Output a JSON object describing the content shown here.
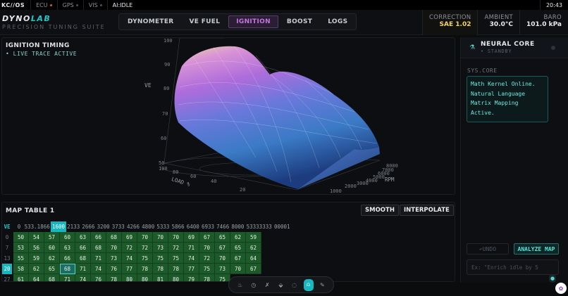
{
  "statusbar": {
    "brand": "KC//OS",
    "items": [
      {
        "label": "ECU",
        "color": "#e04a5a"
      },
      {
        "label": "GPS",
        "color": "#4a4f57"
      },
      {
        "label": "VIS",
        "color": "#4a4f57"
      },
      {
        "label": "AI:IDLE",
        "color": ""
      }
    ],
    "clock": "20:43"
  },
  "header": {
    "logo_main": "DYNO",
    "logo_accent": "LAB",
    "tagline": "PRECISION TUNING SUITE",
    "tabs": [
      {
        "label": "DYNOMETER",
        "active": false
      },
      {
        "label": "VE FUEL",
        "active": false
      },
      {
        "label": "IGNITION",
        "active": true
      },
      {
        "label": "BOOST",
        "active": false
      },
      {
        "label": "LOGS",
        "active": false
      }
    ],
    "readouts": [
      {
        "key": "CORRECTION",
        "value": "SAE 1.02"
      },
      {
        "key": "AMBIENT",
        "value": "30.0°C"
      },
      {
        "key": "BARO",
        "value": "101.0 kPa"
      }
    ]
  },
  "graph": {
    "title": "IGNITION TIMING",
    "status": "• LIVE TRACE ACTIVE",
    "z_label": "VE",
    "z_ticks": [
      "100",
      "90",
      "80",
      "70",
      "60",
      "50"
    ],
    "x_label": "LOAD %",
    "x_ticks": [
      "100",
      "80",
      "60",
      "40",
      "20"
    ],
    "y_label": "RPM",
    "y_ticks": [
      "8000",
      "7000",
      "6000",
      "5000",
      "4000",
      "3000",
      "2000",
      "1000"
    ]
  },
  "map_table": {
    "title": "MAP TABLE 1",
    "smooth": "SMOOTH",
    "interpolate": "INTERPOLATE",
    "corner": "VE",
    "col_headers": [
      "0",
      "533.1866",
      "1600",
      "2133",
      "2666",
      "3200",
      "3733",
      "4266",
      "4800",
      "5333",
      "5866",
      "6400",
      "6933",
      "7466",
      "8000",
      "53333333",
      "00001"
    ],
    "highlight_col": 2,
    "rows": [
      {
        "label": "0",
        "values": [
          "50",
          "54",
          "57",
          "60",
          "63",
          "66",
          "68",
          "69",
          "70",
          "70",
          "70",
          "69",
          "67",
          "65",
          "62",
          "59"
        ]
      },
      {
        "label": "7",
        "values": [
          "53",
          "56",
          "60",
          "63",
          "66",
          "68",
          "70",
          "72",
          "72",
          "73",
          "72",
          "71",
          "70",
          "67",
          "65",
          "62"
        ]
      },
      {
        "label": "13",
        "values": [
          "55",
          "59",
          "62",
          "66",
          "68",
          "71",
          "73",
          "74",
          "75",
          "75",
          "75",
          "74",
          "72",
          "70",
          "67",
          "64"
        ]
      },
      {
        "label": "20",
        "values": [
          "58",
          "62",
          "65",
          "68",
          "71",
          "74",
          "76",
          "77",
          "78",
          "78",
          "78",
          "77",
          "75",
          "73",
          "70",
          "67"
        ]
      },
      {
        "label": "27",
        "values": [
          "61",
          "64",
          "68",
          "71",
          "74",
          "76",
          "78",
          "80",
          "80",
          "81",
          "80",
          "79",
          "78",
          "75",
          "",
          ""
        ]
      }
    ],
    "highlight_row": 3,
    "highlight_cell": [
      3,
      3
    ]
  },
  "side": {
    "title": "NEURAL CORE",
    "status": "• STANDBY",
    "sys_label": "SYS.CORE",
    "message": "Math Kernel Online. Natural Language Matrix Mapping Active.",
    "undo": "↶UNDO",
    "analyze": "ANALYZE MAP",
    "placeholder": "Ex: \"Enrich idle by 5"
  },
  "dock": {
    "icons": [
      "flame-icon",
      "gauge-icon",
      "turbo-icon",
      "drop-icon",
      "chat-icon",
      "brain-icon",
      "pen-icon"
    ],
    "active_index": 5
  }
}
